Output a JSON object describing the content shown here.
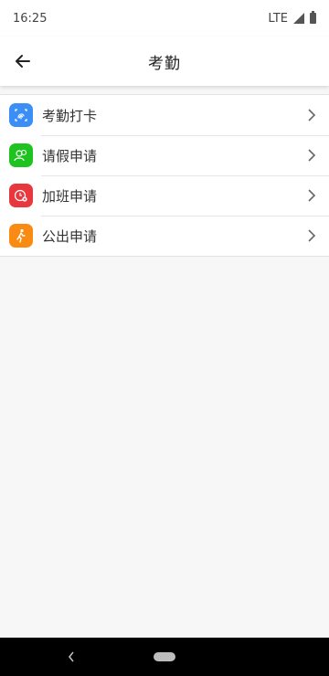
{
  "status_bar": {
    "time": "16:25",
    "network": "LTE"
  },
  "header": {
    "title": "考勤"
  },
  "menu": {
    "items": [
      {
        "label": "考勤打卡",
        "icon": "fingerprint-icon",
        "color": "#3a8ef6"
      },
      {
        "label": "请假申请",
        "icon": "leave-people-icon",
        "color": "#1fc31f"
      },
      {
        "label": "加班申请",
        "icon": "overtime-clock-icon",
        "color": "#e8383d"
      },
      {
        "label": "公出申请",
        "icon": "walking-person-icon",
        "color": "#f98b12"
      }
    ]
  }
}
